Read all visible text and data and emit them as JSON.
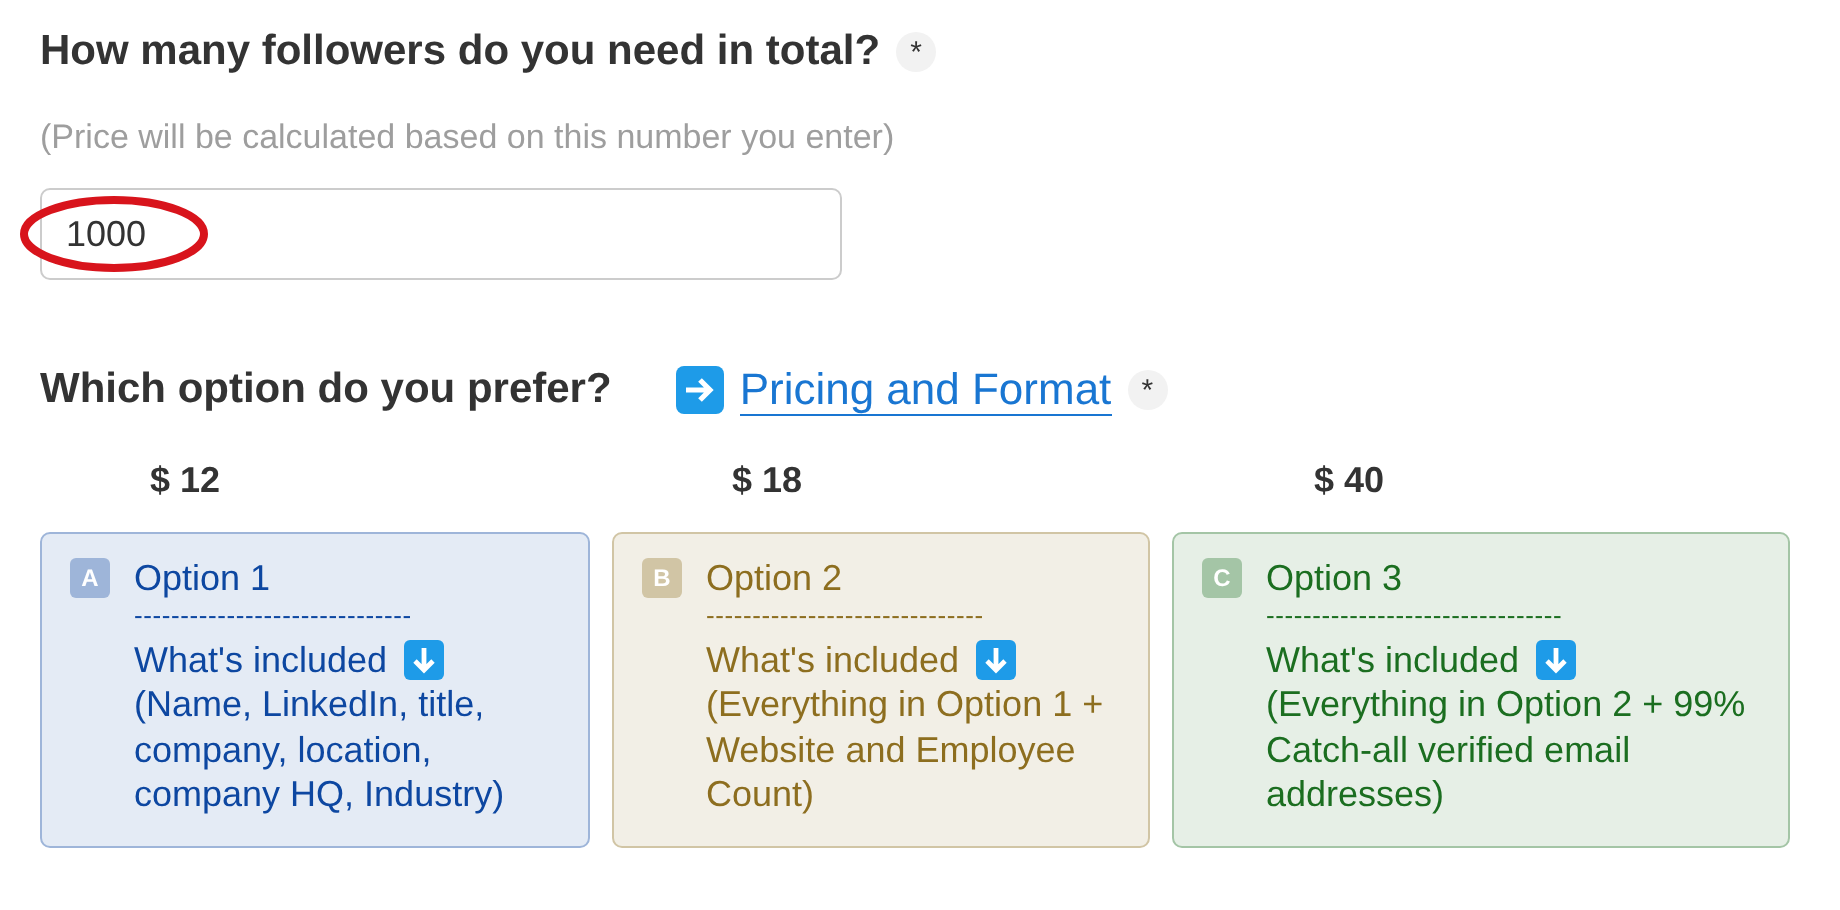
{
  "question_1": {
    "title": "How many followers do you need in total?",
    "required_mark": "*",
    "hint": "(Price will be calculated based on this number you enter)",
    "field": {
      "value": "1000",
      "circled": true
    }
  },
  "question_2": {
    "title": "Which option do you prefer?",
    "link": "Pricing and Format",
    "required_mark": "*",
    "options": [
      {
        "price": "$ 12",
        "letter": "A",
        "title": "Option 1",
        "divider": "------------------------------",
        "included": "What's included",
        "details": "(Name, LinkedIn, title, company, location, company HQ, Industry)",
        "color": "#0d47a1",
        "selected": false
      },
      {
        "price": "$ 18",
        "letter": "B",
        "title": "Option 2",
        "divider": "------------------------------",
        "included": "What's included",
        "details": "(Everything in Option 1 + Website and Employee Count)",
        "color": "#8d6e1f",
        "selected": false
      },
      {
        "price": "$ 40",
        "letter": "C",
        "title": "Option 3",
        "divider": "--------------------------------",
        "included": "What's included",
        "details": "(Everything in Option 2 + 99% Catch-all verified email addresses)",
        "color": "#1b6e20",
        "selected": false
      }
    ]
  }
}
